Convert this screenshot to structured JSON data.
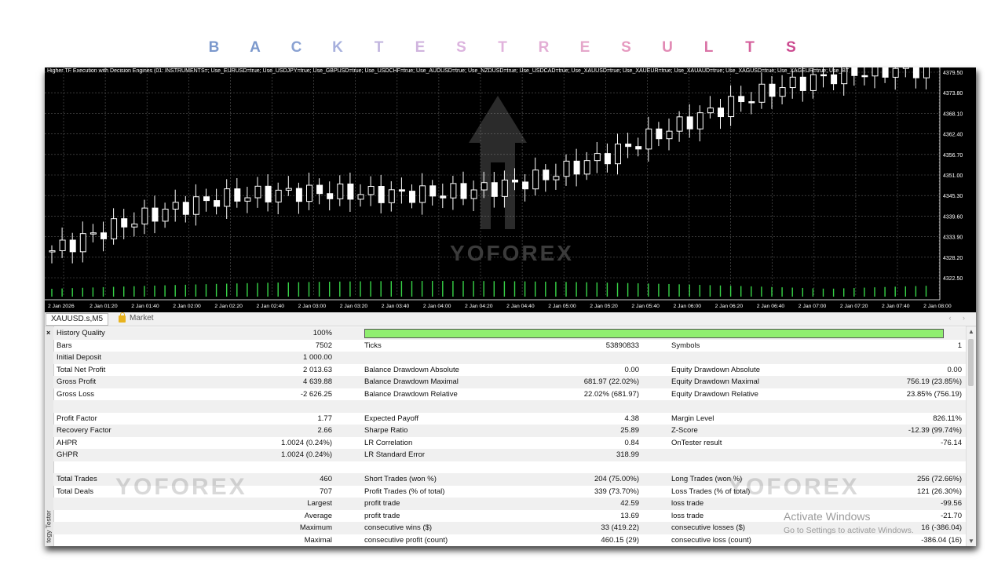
{
  "banner": {
    "letters": [
      "B",
      "A",
      "C",
      "K",
      "T",
      "E",
      "S",
      "T",
      "R",
      "E",
      "S",
      "U",
      "L",
      "T",
      "S"
    ],
    "colors": [
      "#7b98cc",
      "#7b98cc",
      "#8aa2d2",
      "#a7b0dd",
      "#c2b6df",
      "#d0b4de",
      "#dcb4df",
      "#e1b2dc",
      "#e3aed5",
      "#e5a7ca",
      "#e69ac0",
      "#e28bb5",
      "#da74a7",
      "#d4609c",
      "#cc4a90"
    ]
  },
  "chart": {
    "caption": "Higher TF Execution with Decision Engines (01: INSTRUMENTS=; Use_EURUSD=true; Use_USDJPY=true; Use_GBPUSD=true; Use_USDCHF=true; Use_AUDUSD=true; Use_NZDUSD=true; Use_USDCAD=true; Use_XAUUSD=true; Use_XAUEUR=true; Use_XAUAUD=true; Use_XAGUSD=true; Use_XAGEUR=true; Use_BT",
    "price_ticks": [
      "4379.50",
      "4373.80",
      "4368.10",
      "4362.40",
      "4356.70",
      "4351.00",
      "4345.30",
      "4339.60",
      "4333.90",
      "4328.20",
      "4322.50"
    ],
    "time_ticks": [
      "2 Jan 2026",
      "2 Jan 01:20",
      "2 Jan 01:40",
      "2 Jan 02:00",
      "2 Jan 02:20",
      "2 Jan 02:40",
      "2 Jan 03:00",
      "2 Jan 03:20",
      "2 Jan 03:40",
      "2 Jan 04:00",
      "2 Jan 04:20",
      "2 Jan 04:40",
      "2 Jan 05:00",
      "2 Jan 05:20",
      "2 Jan 05:40",
      "2 Jan 06:00",
      "2 Jan 06:20",
      "2 Jan 06:40",
      "2 Jan 07:00",
      "2 Jan 07:20",
      "2 Jan 07:40",
      "2 Jan 08:00"
    ],
    "watermark": "YOFOREX",
    "colors": {
      "background": "#000000",
      "grid": "#5a5a5a",
      "candle_up": "#ffffff",
      "volume": "#37d447",
      "axis_text": "#ffffff"
    }
  },
  "tabs": {
    "active": "XAUUSD.s,M5",
    "market": "Market",
    "nav": "‹ ›"
  },
  "side": {
    "close": "×",
    "label": "tegy Tester"
  },
  "report": {
    "quality": {
      "label": "History Quality",
      "value": "100%"
    },
    "rows": [
      {
        "a": [
          "Bars",
          "7502"
        ],
        "b": [
          "Ticks",
          "53890833"
        ],
        "c": [
          "Symbols",
          "1"
        ]
      },
      {
        "a": [
          "Initial Deposit",
          "1 000.00"
        ],
        "b": [
          "",
          ""
        ],
        "c": [
          "",
          ""
        ]
      },
      {
        "a": [
          "Total Net Profit",
          "2 013.63"
        ],
        "b": [
          "Balance Drawdown Absolute",
          "0.00"
        ],
        "c": [
          "Equity Drawdown Absolute",
          "0.00"
        ]
      },
      {
        "a": [
          "Gross Profit",
          "4 639.88"
        ],
        "b": [
          "Balance Drawdown Maximal",
          "681.97 (22.02%)"
        ],
        "c": [
          "Equity Drawdown Maximal",
          "756.19 (23.85%)"
        ]
      },
      {
        "a": [
          "Gross Loss",
          "-2 626.25"
        ],
        "b": [
          "Balance Drawdown Relative",
          "22.02% (681.97)"
        ],
        "c": [
          "Equity Drawdown Relative",
          "23.85% (756.19)"
        ]
      },
      {
        "a": [
          "",
          ""
        ],
        "b": [
          "",
          ""
        ],
        "c": [
          "",
          ""
        ]
      },
      {
        "a": [
          "Profit Factor",
          "1.77"
        ],
        "b": [
          "Expected Payoff",
          "4.38"
        ],
        "c": [
          "Margin Level",
          "826.11%"
        ]
      },
      {
        "a": [
          "Recovery Factor",
          "2.66"
        ],
        "b": [
          "Sharpe Ratio",
          "25.89"
        ],
        "c": [
          "Z-Score",
          "-12.39 (99.74%)"
        ]
      },
      {
        "a": [
          "AHPR",
          "1.0024 (0.24%)"
        ],
        "b": [
          "LR Correlation",
          "0.84"
        ],
        "c": [
          "OnTester result",
          "-76.14"
        ]
      },
      {
        "a": [
          "GHPR",
          "1.0024 (0.24%)"
        ],
        "b": [
          "LR Standard Error",
          "318.99"
        ],
        "c": [
          "",
          ""
        ]
      },
      {
        "a": [
          "",
          ""
        ],
        "b": [
          "",
          ""
        ],
        "c": [
          "",
          ""
        ]
      },
      {
        "a": [
          "Total Trades",
          "460"
        ],
        "b": [
          "Short Trades (won %)",
          "204 (75.00%)"
        ],
        "c": [
          "Long Trades (won %)",
          "256 (72.66%)"
        ]
      },
      {
        "a": [
          "Total Deals",
          "707"
        ],
        "b": [
          "Profit Trades (% of total)",
          "339 (73.70%)"
        ],
        "c": [
          "Loss Trades (% of total)",
          "121 (26.30%)"
        ]
      },
      {
        "a": [
          "",
          "Largest"
        ],
        "b": [
          "profit trade",
          "42.59"
        ],
        "c": [
          "loss trade",
          "-99.56"
        ]
      },
      {
        "a": [
          "",
          "Average"
        ],
        "b": [
          "profit trade",
          "13.69"
        ],
        "c": [
          "loss trade",
          "-21.70"
        ]
      },
      {
        "a": [
          "",
          "Maximum"
        ],
        "b": [
          "consecutive wins ($)",
          "33 (419.22)"
        ],
        "c": [
          "consecutive losses ($)",
          "16 (-386.04)"
        ]
      },
      {
        "a": [
          "",
          "Maximal"
        ],
        "b": [
          "consecutive profit (count)",
          "460.15 (29)"
        ],
        "c": [
          "consecutive loss (count)",
          "-386.04 (16)"
        ]
      }
    ],
    "watermark": "YOFOREX"
  },
  "activation": {
    "title": "Activate Windows",
    "subtitle": "Go to Settings to activate Windows."
  }
}
